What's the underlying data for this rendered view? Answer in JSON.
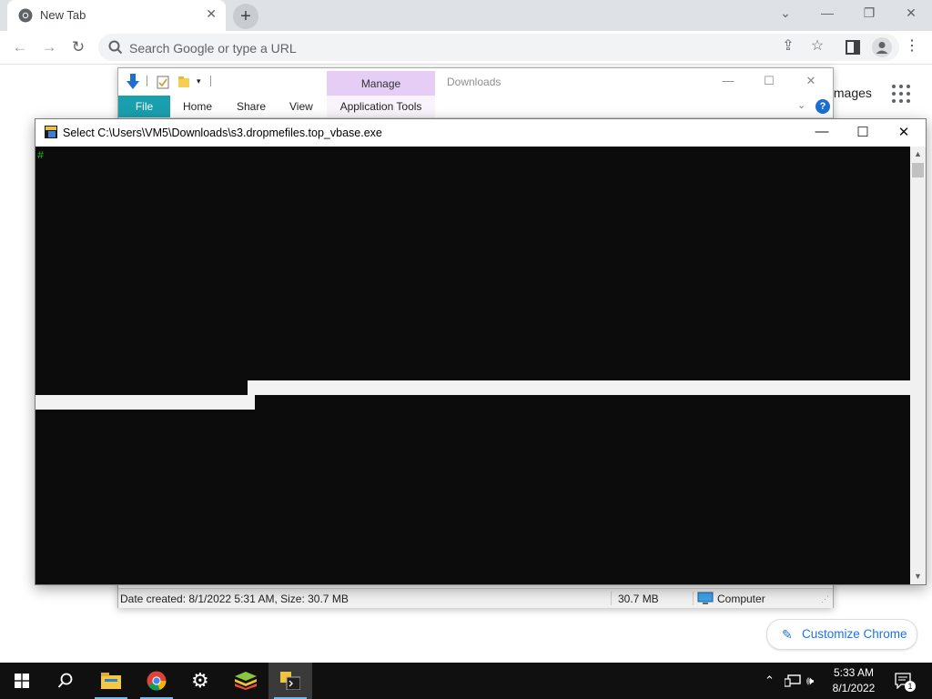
{
  "chrome": {
    "tab_title": "New Tab",
    "tab_close": "✕",
    "new_tab": "+",
    "omnibox_placeholder": "Search Google or type a URL",
    "images_link": "Images",
    "customize_label": "Customize Chrome",
    "icons": [
      "chrome-logo-icon",
      "back-icon",
      "forward-icon",
      "reload-icon",
      "search-icon",
      "share-icon",
      "star-icon",
      "side-panel-icon",
      "profile-icon",
      "menu-icon",
      "apps-grid-icon",
      "pencil-icon"
    ]
  },
  "explorer": {
    "manage_tab": "Manage",
    "title": "Downloads",
    "ribbon_tabs": [
      "File",
      "Home",
      "Share",
      "View",
      "Application Tools"
    ],
    "status": {
      "info": "Date created: 8/1/2022 5:31 AM, Size: 30.7 MB",
      "size": "30.7 MB",
      "location": "Computer"
    }
  },
  "console": {
    "title": "Select C:\\Users\\VM5\\Downloads\\s3.dropmefiles.top_vbase.exe",
    "prompt": "#",
    "minimize": "—",
    "maximize": "☐",
    "close": "✕"
  },
  "taskbar": {
    "time": "5:33 AM",
    "date": "8/1/2022",
    "notification_count": "1",
    "apps": [
      "start-icon",
      "search-icon",
      "file-explorer-icon",
      "chrome-icon",
      "settings-icon",
      "bluestacks-icon",
      "console-app-icon"
    ]
  },
  "colors": {
    "file_tab": "#1a9fae",
    "manage_tab": "#e6cdf5",
    "console_bg": "#0c0c0c",
    "prompt": "#16c60c",
    "link": "#1a73e8"
  }
}
